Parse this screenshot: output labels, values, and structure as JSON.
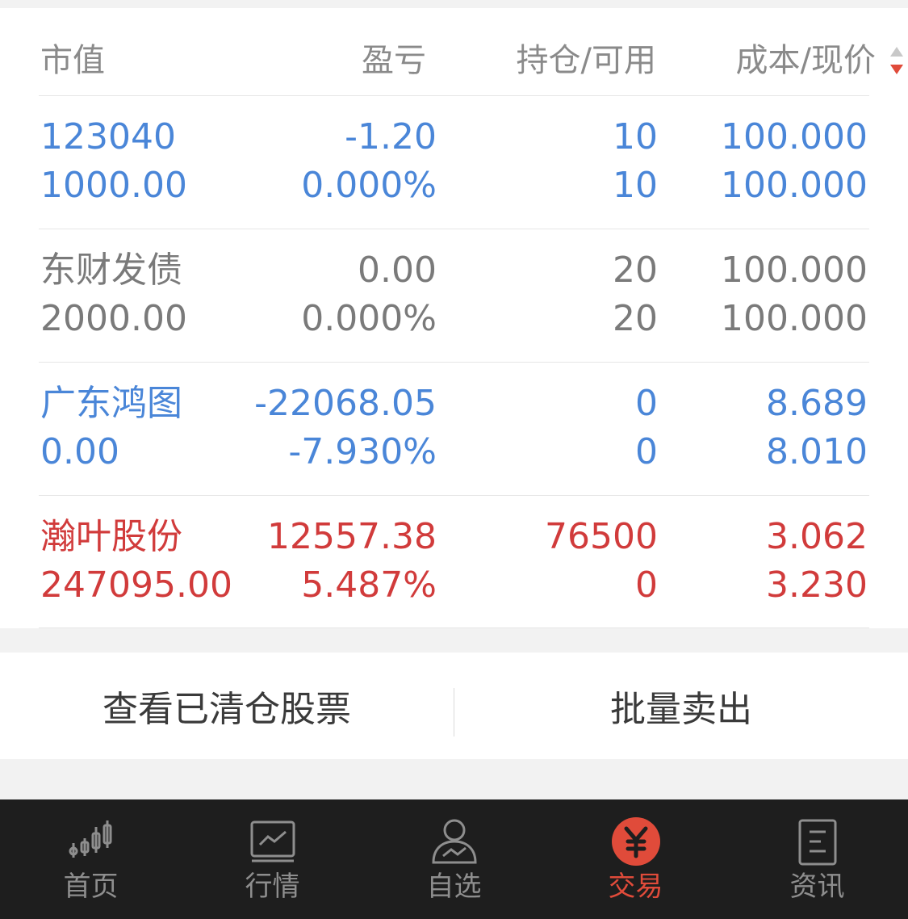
{
  "header": {
    "col_market_value": "市值",
    "col_profit_loss": "盈亏",
    "col_position": "持仓/可用",
    "col_cost_price": "成本/现价"
  },
  "colors": {
    "blue": "#4a86d8",
    "gray": "#7a7a7a",
    "red": "#d13b3b",
    "accent": "#e04b3a"
  },
  "rows": [
    {
      "name": "123040",
      "market_value": "1000.00",
      "profit": "-1.20",
      "profit_pct": "0.000%",
      "position": "10",
      "available": "10",
      "cost": "100.000",
      "price": "100.000",
      "tone": "blue"
    },
    {
      "name": "东财发债",
      "market_value": "2000.00",
      "profit": "0.00",
      "profit_pct": "0.000%",
      "position": "20",
      "available": "20",
      "cost": "100.000",
      "price": "100.000",
      "tone": "gray"
    },
    {
      "name": "广东鸿图",
      "market_value": "0.00",
      "profit": "-22068.05",
      "profit_pct": "-7.930%",
      "position": "0",
      "available": "0",
      "cost": "8.689",
      "price": "8.010",
      "tone": "blue"
    },
    {
      "name": "瀚叶股份",
      "market_value": "247095.00",
      "profit": "12557.38",
      "profit_pct": "5.487%",
      "position": "76500",
      "available": "0",
      "cost": "3.062",
      "price": "3.230",
      "tone": "red"
    }
  ],
  "actions": {
    "view_cleared": "查看已清仓股票",
    "batch_sell": "批量卖出"
  },
  "nav": {
    "items": [
      {
        "label": "首页",
        "icon": "candlestick-icon"
      },
      {
        "label": "行情",
        "icon": "line-chart-icon"
      },
      {
        "label": "自选",
        "icon": "user-chart-icon"
      },
      {
        "label": "交易",
        "icon": "yuan-icon"
      },
      {
        "label": "资讯",
        "icon": "document-icon"
      }
    ],
    "active_index": 3
  }
}
